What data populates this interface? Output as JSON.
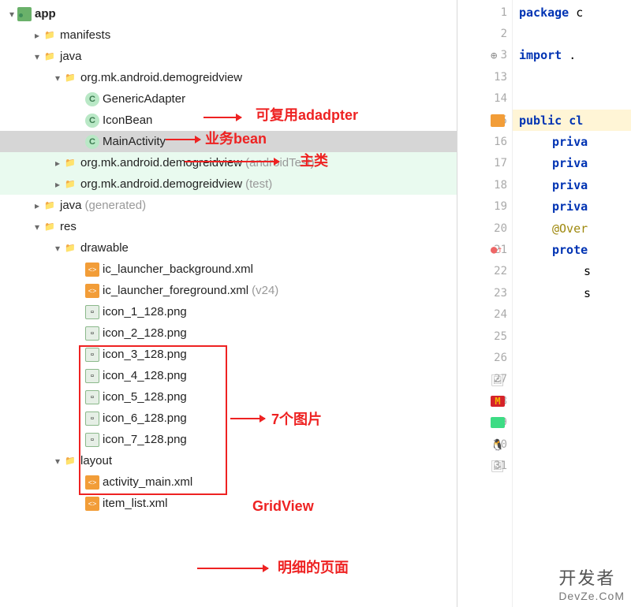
{
  "tree": {
    "app": "app",
    "manifests": "manifests",
    "java": "java",
    "pkg_main": "org.mk.android.demogreidview",
    "cls_generic": "GenericAdapter",
    "cls_iconbean": "IconBean",
    "cls_main": "MainActivity",
    "pkg_androidtest": "org.mk.android.demogreidview",
    "pkg_androidtest_suffix": "(androidTest)",
    "pkg_test": "org.mk.android.demogreidview",
    "pkg_test_suffix": "(test)",
    "java_gen": "java",
    "java_gen_suffix": "(generated)",
    "res": "res",
    "drawable": "drawable",
    "xml_bg": "ic_launcher_background.xml",
    "xml_fg": "ic_launcher_foreground.xml",
    "xml_fg_suffix": "(v24)",
    "icons": [
      "icon_1_128.png",
      "icon_2_128.png",
      "icon_3_128.png",
      "icon_4_128.png",
      "icon_5_128.png",
      "icon_6_128.png",
      "icon_7_128.png"
    ],
    "layout": "layout",
    "layout_main": "activity_main.xml",
    "layout_item": "item_list.xml"
  },
  "gutter_lines": [
    "1",
    "2",
    "3",
    "13",
    "14",
    "15",
    "16",
    "17",
    "18",
    "19",
    "20",
    "21",
    "22",
    "23",
    "24",
    "25",
    "26",
    "27",
    "28",
    "29",
    "30",
    "31"
  ],
  "code": {
    "l1": "package",
    "l1b": "c",
    "l3": "import",
    "l3b": ".",
    "l15a": "public",
    "l15b": "cl",
    "l16": "priva",
    "l17": "priva",
    "l18": "priva",
    "l19": "priva",
    "l20": "@Over",
    "l21": "prote",
    "l22": "s",
    "l23": "s"
  },
  "annotations": {
    "adapter": "可复用adadpter",
    "bean": "业务bean",
    "mainclass": "主类",
    "images7": "7个图片",
    "gridview": "GridView",
    "detailpage": "明细的页面"
  },
  "watermark": {
    "line1": "开发者",
    "line2": "DevZe.CoM"
  }
}
